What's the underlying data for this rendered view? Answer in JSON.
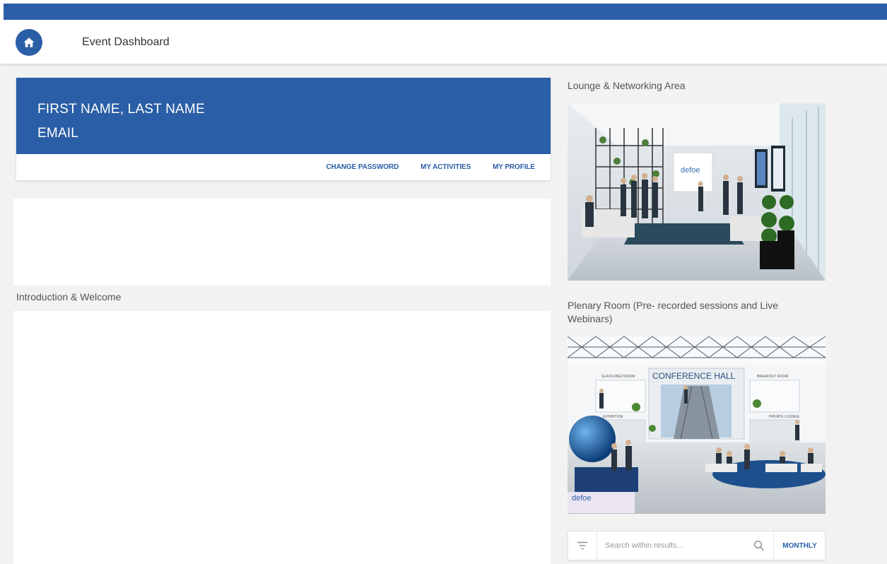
{
  "header": {
    "title": "Event Dashboard",
    "home_icon": "home-icon"
  },
  "profile": {
    "name": "FIRST NAME, LAST NAME",
    "email": "EMAIL",
    "links": [
      "CHANGE PASSWORD",
      "MY ACTIVITIES",
      "MY PROFILE"
    ]
  },
  "sections": {
    "intro_label": "Introduction & Welcome",
    "lounge_label": "Lounge & Networking Area",
    "plenary_label": "Plenary Room (Pre- recorded sessions and Live Webinars)"
  },
  "plenary_image": {
    "sign_main": "CONFERENCE HALL",
    "sign_left": "GLASS MEETROOM",
    "sign_right": "BREAKOUT ROOM",
    "sign_exhibition": "EXHIBITION",
    "sign_lounge": "PRIVATE LOUNGE",
    "logo": "defoe"
  },
  "lounge_image": {
    "logo": "defoe"
  },
  "search": {
    "placeholder": "Search within results...",
    "period": "MONTHLY"
  },
  "colors": {
    "brand": "#2a5ea6",
    "background": "#f2f2f2"
  }
}
